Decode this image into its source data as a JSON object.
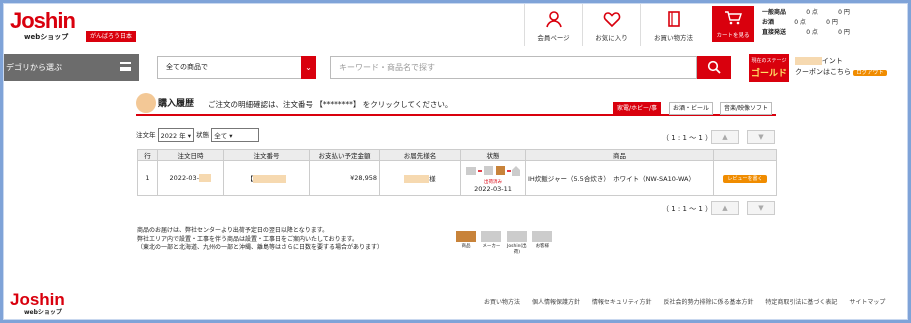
{
  "header": {
    "logo": "Joshin",
    "logo_sub": "webショップ",
    "tagline": "がんばろう日本",
    "nav": [
      {
        "label": "会員ページ",
        "icon": "user-icon"
      },
      {
        "label": "お気に入り",
        "icon": "heart-icon"
      },
      {
        "label": "お買い物方法",
        "icon": "book-icon"
      }
    ],
    "cart_label": "カートを見る",
    "points": [
      {
        "label": "一般商品",
        "value": "0 点",
        "unit": "0 円"
      },
      {
        "label": "お酒",
        "value": "0 点",
        "unit": "0 円"
      },
      {
        "label": "直接発送",
        "value": "0 点",
        "unit": "0 円"
      }
    ]
  },
  "searchbar": {
    "category_button": "デゴリから選ぶ",
    "category_select": "全ての商品で",
    "search_placeholder": "キーワード・商品名で探す",
    "stage_label": "現在のステージ",
    "stage_value": "ゴールド",
    "points_suffix": "イント",
    "coupon_text": "クーポンはこちら",
    "logout": "ログアウト"
  },
  "page": {
    "title": "購入履歴",
    "instruction": "ご注文の明細確認は、注文番号 【********】 をクリックしてください。",
    "tabs": [
      "家電/ホビー/事",
      "お酒・ビール",
      "音楽/映像ソフト"
    ]
  },
  "filters": {
    "year_label": "注文年",
    "year_value": "2022 年",
    "status_label": "状態",
    "status_value": "全て"
  },
  "pager": {
    "text": "（ 1 : 1 ～ 1 ）",
    "prev": "▲",
    "next": "▼"
  },
  "table": {
    "headers": [
      "行",
      "注文日時",
      "注文番号",
      "お支払い予定金額",
      "お届先様名",
      "状態",
      "商品",
      ""
    ],
    "rows": [
      {
        "row": "1",
        "date": "2022-03-",
        "order_no": "【",
        "amount": "¥28,958",
        "recipient": "様",
        "status_label": "出荷済み",
        "status_date": "2022-03-11",
        "product": "IH炊飯ジャー（5.5合炊き）　ホワイト（NW-SA10-WA）",
        "review": "レビューを書く"
      }
    ]
  },
  "notes": [
    "商品のお届けは、弊社センターより出荷予定日の翌日以降となります。",
    "弊社エリア内で設置・工事を伴う商品は設置・工事日をご案内いたしております。",
    "（東北の一部と北海道、九州の一部と沖縄、離島等はさらに日数を要する場合があります）"
  ],
  "legend": [
    "商品",
    "メーカー",
    "Joshin(出荷)",
    "お客様"
  ],
  "footer": {
    "logo": "Joshin",
    "logo_sub": "webショップ",
    "links": [
      "お買い物方法",
      "個人情報保護方針",
      "情報セキュリティ方針",
      "反社会的勢力排除に係る基本方針",
      "特定商取引法に基づく表記",
      "サイトマップ"
    ]
  },
  "colors": {
    "accent": "#d9000d",
    "orange": "#f08c00",
    "gold": "#ffe066"
  }
}
